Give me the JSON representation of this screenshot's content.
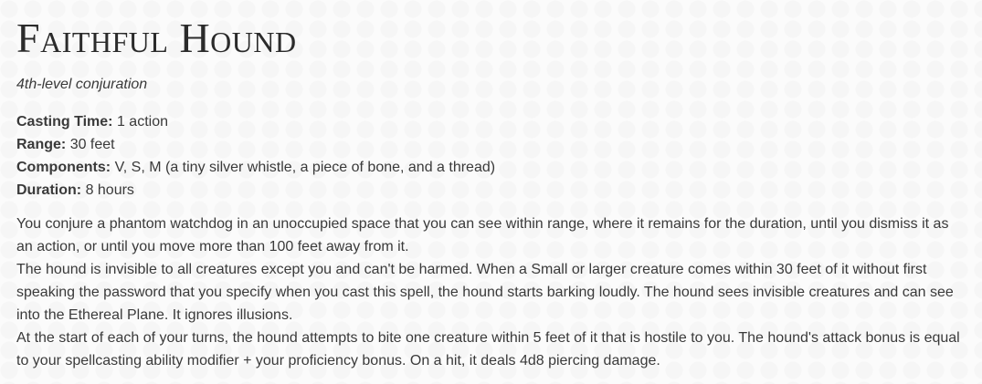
{
  "spell": {
    "title": "Faithful Hound",
    "school_line": "4th-level conjuration",
    "casting_time": {
      "label": "Casting Time:",
      "value": "1 action"
    },
    "range": {
      "label": "Range:",
      "value": "30 feet"
    },
    "components": {
      "label": "Components:",
      "value": "V, S, M (a tiny silver whistle, a piece of bone, and a thread)"
    },
    "duration": {
      "label": "Duration:",
      "value": "8 hours"
    },
    "paragraphs": [
      "You conjure a phantom watchdog in an unoccupied space that you can see within range, where it remains for the duration, until you dismiss it as an action, or until you move more than 100 feet away from it.",
      "The hound is invisible to all creatures except you and can't be harmed. When a Small or larger creature comes within 30 feet of it without first speaking the password that you specify when you cast this spell, the hound starts barking loudly. The hound sees invisible creatures and can see into the Ethereal Plane. It ignores illusions.",
      "At the start of each of your turns, the hound attempts to bite one creature within 5 feet of it that is hostile to you. The hound's attack bonus is equal to your spellcasting ability modifier + your proficiency bonus. On a hit, it deals 4d8 piercing damage."
    ]
  }
}
